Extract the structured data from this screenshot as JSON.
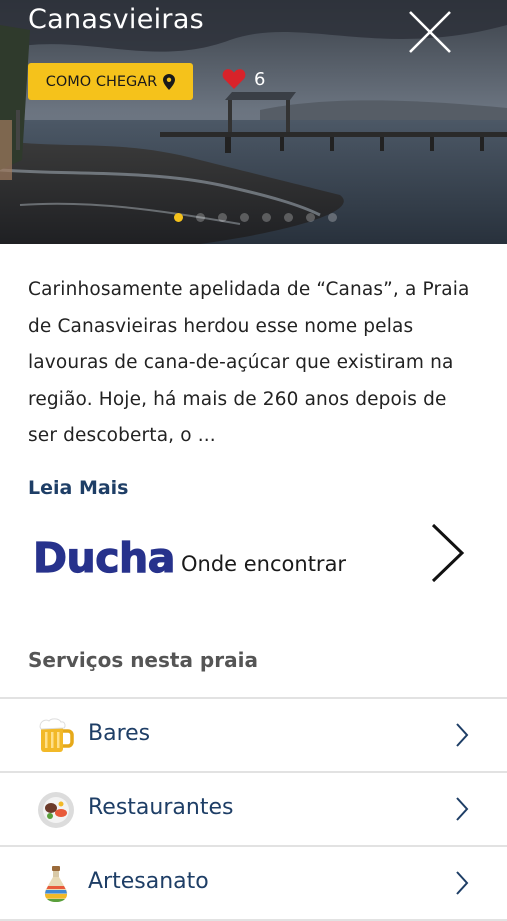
{
  "header": {
    "title": "Canasvieiras",
    "cta_label": "COMO CHEGAR",
    "likes_count": "6"
  },
  "colors": {
    "accent_yellow": "#f5c21b",
    "heart_red": "#d8232a",
    "link_blue": "#1e3e66",
    "brand_navy": "#27328c"
  },
  "gallery": {
    "total": 8,
    "active": 0
  },
  "description": {
    "lines": [
      "Carinhosamente apelidada de “Canas”, a Praia",
      "de Canasvieiras herdou esse nome pelas",
      "lavouras de cana-de-açúcar que existiram na",
      "região. Hoje, há mais de 260 anos depois de",
      "ser descoberta, o ..."
    ],
    "read_more": "Leia Mais"
  },
  "ducha": {
    "name": "Ducha",
    "subtitle": "Onde encontrar"
  },
  "services": {
    "title": "Serviços nesta praia",
    "items": [
      {
        "label": "Bares",
        "icon": "beer-mug-icon"
      },
      {
        "label": "Restaurantes",
        "icon": "food-plate-icon"
      },
      {
        "label": "Artesanato",
        "icon": "sand-bottle-icon"
      }
    ]
  }
}
